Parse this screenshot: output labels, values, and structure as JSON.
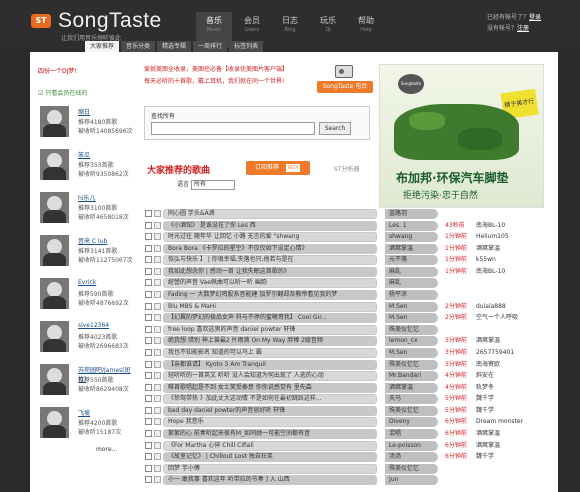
{
  "header": {
    "logo_badge": "ST",
    "logo_text": "SongTaste",
    "slogan": "让我们用音乐倾听彼此",
    "nav": [
      {
        "label": "音乐",
        "sub": "Music",
        "active": true
      },
      {
        "label": "会员",
        "sub": "Users",
        "active": false
      },
      {
        "label": "日志",
        "sub": "Blog",
        "active": false
      },
      {
        "label": "玩乐",
        "sub": "DJ",
        "active": false
      },
      {
        "label": "帮助",
        "sub": "Help",
        "active": false
      }
    ],
    "user": {
      "account_prompt": "已经有帐号了？",
      "login": "登录",
      "no_account_prompt": "没有帐号？",
      "register": "注册"
    }
  },
  "subnav": [
    {
      "label": "大家推荐",
      "active": true
    },
    {
      "label": "音乐分类",
      "active": false
    },
    {
      "label": "精选专辑",
      "active": false
    },
    {
      "label": "一周排行",
      "active": false
    },
    {
      "label": "标签列表",
      "active": false
    }
  ],
  "left": {
    "heading": "四份一个DJ梦!",
    "checkbox_label": "只看会员在线的",
    "djs": [
      {
        "name": "缩日",
        "line1": "推荐4180首歌",
        "line2": "被收听14085696次"
      },
      {
        "name": "笨瓜",
        "line1": "推荐353首歌",
        "line2": "被收听9350862次"
      },
      {
        "name": "hi乐儿",
        "line1": "推荐3100首歌",
        "line2": "被收听4658018次"
      },
      {
        "name": "音来 C lub",
        "line1": "推荐3141首歌",
        "line2": "被收听11275067次"
      },
      {
        "name": "Evrick",
        "line1": "推荐590首歌",
        "line2": "被收听4876692次"
      },
      {
        "name": "sive12364",
        "line1": "推荐4023首歌",
        "line2": "被收听2696683次"
      },
      {
        "name": "苏苑园吧/James(斑竹)",
        "line1": "推荐550首歌",
        "line2": "被收听8629408次"
      },
      {
        "name": "飞坡",
        "line1": "推荐4200首歌",
        "line2": "被收听15187次"
      }
    ],
    "more": "more..."
  },
  "center": {
    "announce1": "爱就美图全收录，美图控必备【收录优美图片客户端】",
    "announce2": "每天必听的十首歌，戴上耳机，我们就在同一个世界!",
    "radio_button": "SongTaste 电台",
    "search_label": "查找所有",
    "search_button": "Search",
    "rec_title": "大家推荐的歌曲",
    "subscribe_button": "订阅推荐",
    "beta": "BETA",
    "analyzer": "ST分析器",
    "lang_label": "语言",
    "lang_value": "所有"
  },
  "ad": {
    "brand": "Songtaste",
    "stamp": "精于美才行",
    "line1": "布加邦·环保汽车脚垫",
    "line2": "拒绝污染·忠于自然"
  },
  "songs": [
    {
      "title": "同心圆 芋头&A滴",
      "dj": "蓝路羽",
      "time": "",
      "who": ""
    },
    {
      "title": "《小酒馆》 是谁没花了你 Les 西",
      "dj": "Les. 1",
      "time": "43秒前",
      "who": "南海BL-10"
    },
    {
      "title": "时光过往 随年华 让回忆 小路 无言的爱 \"shwang",
      "dj": "shwang",
      "time": "1分钟前",
      "who": "Helium105"
    },
    {
      "title": "Bora Bora 《卡罗拉的星空》不仅仅如下设定心情》",
      "dj": "酒窝掌温",
      "time": "1分钟前",
      "who": "酒窝掌温"
    },
    {
      "title": "恢弘与快乐 】 | 你很幸福,失落也只,他若与是在",
      "dj": "元不落",
      "time": "1分钟前",
      "who": "k55wn"
    },
    {
      "title": "我如此想念你 | 感动一首 让我失眠这首歌的》",
      "dj": "麻乱",
      "time": "1分钟前",
      "who": "南海BL-10"
    },
    {
      "title": "經營的声音 Vae佩曲可以听一听 幽韵",
      "dj": "麻乱",
      "time": "",
      "who": ""
    },
    {
      "title": "Fading 一 大数梦幻鸣股系音能建 加罗尔翻却及教帝看见我的梦",
      "dj": "杨平凉",
      "time": "",
      "who": ""
    },
    {
      "title": "Blu MBS & MaHi",
      "dj": "M.Sen",
      "time": "2分钟前",
      "who": "dulala888"
    },
    {
      "title": "【幻翼的梦幻的极品女声 轩与不停的蜜曦哥我】 Cool Gir...",
      "dj": "M.Sen",
      "time": "2分钟前",
      "who": "空气一个人呼吸"
    },
    {
      "title": "free loop 喜欢这男的声音 daniel powter 轩锋",
      "dj": "殊美仪忆忆",
      "time": "",
      "who": ""
    },
    {
      "title": "绝我想 惜别 神上曾最2 片雨滴 On My Way 胖棒 2级音频",
      "dj": "lemon_cx",
      "time": "3分钟前",
      "who": "酒窝掌温"
    },
    {
      "title": "我也不知能影名 知道的可以马上 霸",
      "dj": "M.Sen",
      "time": "3分钟前",
      "who": "2657759401"
    },
    {
      "title": "【亲都谁请】 Kyoto 3 Am Tranquil",
      "dj": "殊美仪忆忆",
      "time": "3分钟前",
      "who": "南海寄欧"
    },
    {
      "title": "轻听听的一首英文 听听 没人会知道为何出现了 人逃的心动",
      "dj": "Mr.Bandari",
      "time": "4分钟前",
      "who": "斜安在"
    },
    {
      "title": "唯首歌唱起是不到 女士笑受泰意 你你说感觉有 里先森",
      "dj": "酒窝掌温",
      "time": "4分钟前",
      "who": "轨梦冬"
    },
    {
      "title": "《惊驾带热 》加此丈大这动情 不是如何在最初跳跃这样...",
      "dj": "天马",
      "time": "5分钟前",
      "who": "魏千学"
    },
    {
      "title": "bad day daniel powter的声音很好听 轩锋",
      "dj": "殊美仪忆忆",
      "time": "5分钟前",
      "who": "魏千学"
    },
    {
      "title": "Hope 我音乐",
      "dj": "Diveny",
      "time": "6分钟前",
      "who": "Dream monster"
    },
    {
      "title": "絮絮的心 前奏听起来很有M_如同她一可能空间都有音",
      "dj": "混唱",
      "time": "6分钟前",
      "who": "酒窝掌温"
    },
    {
      "title": "《For Martha 心碎 Chill Cifiali",
      "dj": "Le-poisson",
      "time": "6分钟前",
      "who": "酒窝掌温"
    },
    {
      "title": "《故室记忆》 | Chillout Lost 独自狂笑",
      "dj": "汤汤",
      "time": "6分钟前",
      "who": "魏千学"
    },
    {
      "title": "回梦 芋小傅",
      "dj": "殊美仪忆忆",
      "time": "",
      "who": ""
    },
    {
      "title": "小一 敢我事 喜欢这年 听带拉的节奏 ] 入 山西",
      "dj": "Jun",
      "time": "",
      "who": ""
    }
  ]
}
